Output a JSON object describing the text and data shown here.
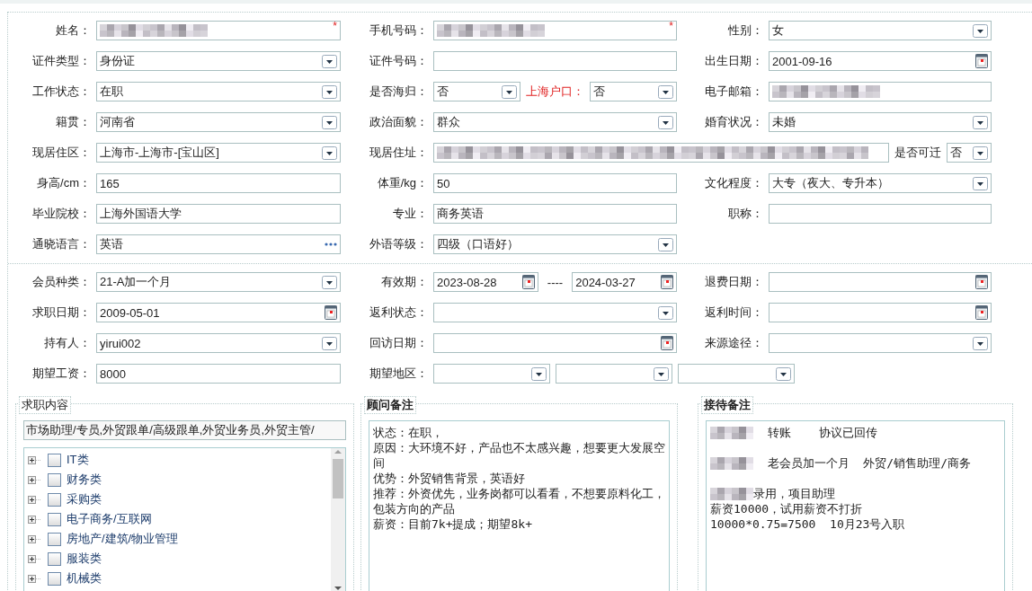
{
  "sections": [
    {
      "rows": [
        {
          "columns": [
            {
              "parts": [
                {
                  "kind": "label",
                  "text": "姓名："
                },
                {
                  "kind": "text",
                  "redacted": true,
                  "required_mark": "*"
                }
              ]
            },
            {
              "parts": [
                {
                  "kind": "label",
                  "text": "手机号码："
                },
                {
                  "kind": "text",
                  "redacted": true,
                  "required_mark": "*"
                }
              ]
            },
            {
              "parts": [
                {
                  "kind": "label",
                  "text": "性别："
                },
                {
                  "kind": "select",
                  "value": "女"
                }
              ]
            }
          ]
        },
        {
          "columns": [
            {
              "parts": [
                {
                  "kind": "label",
                  "text": "证件类型："
                },
                {
                  "kind": "select",
                  "value": "身份证"
                }
              ]
            },
            {
              "parts": [
                {
                  "kind": "label",
                  "text": "证件号码："
                },
                {
                  "kind": "text"
                }
              ]
            },
            {
              "parts": [
                {
                  "kind": "label",
                  "text": "出生日期："
                },
                {
                  "kind": "date",
                  "value": "2001-09-16"
                }
              ]
            }
          ]
        },
        {
          "columns": [
            {
              "parts": [
                {
                  "kind": "label",
                  "text": "工作状态："
                },
                {
                  "kind": "select",
                  "value": "在职"
                }
              ]
            },
            {
              "parts": [
                {
                  "kind": "label",
                  "text": "是否海归："
                },
                {
                  "kind": "select",
                  "value": "否"
                },
                {
                  "kind": "label",
                  "text": "上海户口：",
                  "emphasis": true
                },
                {
                  "kind": "select",
                  "value": "否"
                }
              ]
            },
            {
              "parts": [
                {
                  "kind": "label",
                  "text": "电子邮箱："
                },
                {
                  "kind": "text",
                  "redacted": true
                }
              ]
            }
          ]
        },
        {
          "columns": [
            {
              "parts": [
                {
                  "kind": "label",
                  "text": "籍贯："
                },
                {
                  "kind": "select",
                  "value": "河南省"
                }
              ]
            },
            {
              "parts": [
                {
                  "kind": "label",
                  "text": "政治面貌："
                },
                {
                  "kind": "select",
                  "value": "群众"
                }
              ]
            },
            {
              "parts": [
                {
                  "kind": "label",
                  "text": "婚育状况："
                },
                {
                  "kind": "select",
                  "value": "未婚"
                }
              ]
            }
          ]
        },
        {
          "columns": [
            {
              "parts": [
                {
                  "kind": "label",
                  "text": "现居住区："
                },
                {
                  "kind": "select",
                  "value": " 上海市-上海市-[宝山区]"
                }
              ]
            },
            {
              "parts": [
                {
                  "kind": "label",
                  "text": "现居住址："
                },
                {
                  "kind": "text",
                  "redacted": true
                },
                {
                  "kind": "label",
                  "text": "是否可迁"
                },
                {
                  "kind": "select",
                  "value": "否"
                }
              ]
            }
          ]
        },
        {
          "columns": [
            {
              "parts": [
                {
                  "kind": "label",
                  "text": "身高/cm："
                },
                {
                  "kind": "text",
                  "value": "165"
                }
              ]
            },
            {
              "parts": [
                {
                  "kind": "label",
                  "text": "体重/kg："
                },
                {
                  "kind": "text",
                  "value": "50"
                }
              ]
            },
            {
              "parts": [
                {
                  "kind": "label",
                  "text": "文化程度："
                },
                {
                  "kind": "select",
                  "value": "大专（夜大、专升本）"
                }
              ]
            }
          ]
        },
        {
          "columns": [
            {
              "parts": [
                {
                  "kind": "label",
                  "text": "毕业院校："
                },
                {
                  "kind": "text",
                  "value": "上海外国语大学"
                }
              ]
            },
            {
              "parts": [
                {
                  "kind": "label",
                  "text": "专业："
                },
                {
                  "kind": "text",
                  "value": "商务英语"
                }
              ]
            },
            {
              "parts": [
                {
                  "kind": "label",
                  "text": "职称："
                },
                {
                  "kind": "text"
                }
              ]
            }
          ]
        },
        {
          "columns": [
            {
              "parts": [
                {
                  "kind": "label",
                  "text": "通晓语言："
                },
                {
                  "kind": "lookup",
                  "value": "英语"
                }
              ]
            },
            {
              "parts": [
                {
                  "kind": "label",
                  "text": "外语等级："
                },
                {
                  "kind": "select",
                  "value": "四级（口语好）"
                }
              ]
            }
          ]
        }
      ]
    },
    {
      "rows": [
        {
          "columns": [
            {
              "parts": [
                {
                  "kind": "label",
                  "text": "会员种类："
                },
                {
                  "kind": "select",
                  "value": " 21-A加一个月"
                }
              ]
            },
            {
              "parts": [
                {
                  "kind": "label",
                  "text": "有效期："
                },
                {
                  "kind": "date",
                  "value": "2023-08-28"
                },
                {
                  "kind": "dash",
                  "text": "----"
                },
                {
                  "kind": "date",
                  "value": "2024-03-27"
                }
              ]
            },
            {
              "parts": [
                {
                  "kind": "label",
                  "text": "退费日期："
                },
                {
                  "kind": "date"
                }
              ]
            }
          ]
        },
        {
          "columns": [
            {
              "parts": [
                {
                  "kind": "label",
                  "text": "求职日期："
                },
                {
                  "kind": "date",
                  "value": "2009-05-01"
                }
              ]
            },
            {
              "parts": [
                {
                  "kind": "label",
                  "text": "返利状态："
                },
                {
                  "kind": "select"
                }
              ]
            },
            {
              "parts": [
                {
                  "kind": "label",
                  "text": "返利时间："
                },
                {
                  "kind": "date"
                }
              ]
            }
          ]
        },
        {
          "columns": [
            {
              "parts": [
                {
                  "kind": "label",
                  "text": "持有人："
                },
                {
                  "kind": "select",
                  "value": "yirui002"
                }
              ]
            },
            {
              "parts": [
                {
                  "kind": "label",
                  "text": "回访日期："
                },
                {
                  "kind": "date"
                }
              ]
            },
            {
              "parts": [
                {
                  "kind": "label",
                  "text": "来源途径："
                },
                {
                  "kind": "select"
                }
              ]
            }
          ]
        },
        {
          "columns": [
            {
              "parts": [
                {
                  "kind": "label",
                  "text": "期望工资："
                },
                {
                  "kind": "text",
                  "value": "8000"
                }
              ]
            },
            {
              "parts": [
                {
                  "kind": "label",
                  "text": "期望地区："
                },
                {
                  "kind": "select"
                },
                {
                  "kind": "select"
                },
                {
                  "kind": "select"
                }
              ]
            }
          ]
        }
      ]
    }
  ],
  "job_panel": {
    "legend": "求职内容",
    "strong": false,
    "value": "市场助理/专员,外贸跟单/高级跟单,外贸业务员,外贸主管/",
    "tree": [
      {
        "label": "IT类",
        "checked": false,
        "expanded": false
      },
      {
        "label": "财务类",
        "checked": false,
        "expanded": false
      },
      {
        "label": "采购类",
        "checked": false,
        "expanded": false
      },
      {
        "label": "电子商务/互联网",
        "checked": false,
        "expanded": false
      },
      {
        "label": "房地产/建筑/物业管理",
        "checked": false,
        "expanded": false
      },
      {
        "label": "服装类",
        "checked": false,
        "expanded": false
      },
      {
        "label": "机械类",
        "checked": false,
        "expanded": false
      }
    ]
  },
  "note_panels": [
    {
      "legend": "顾问备注",
      "strong": true,
      "lines": [
        {
          "kind": "text",
          "text": "状态：在职，"
        },
        {
          "kind": "text",
          "text": "原因：大环境不好，产品也不太感兴趣，想要更大发展空间"
        },
        {
          "kind": "text",
          "text": "优势：外贸销售背景，英语好"
        },
        {
          "kind": "text",
          "text": "推荐：外资优先，业务岗都可以看看，不想要原料化工，包装方向的产品"
        },
        {
          "kind": "text",
          "text": "薪资：目前7k+提成；期望8k+"
        }
      ]
    },
    {
      "legend": "接待备注",
      "strong": true,
      "lines": [
        {
          "kind": "redacted",
          "text": "  转账    协议已回传"
        },
        {
          "kind": "blank"
        },
        {
          "kind": "redacted",
          "text": "  老会员加一个月  外贸/销售助理/商务"
        },
        {
          "kind": "blank"
        },
        {
          "kind": "redacted",
          "text": "录用，项目助理"
        },
        {
          "kind": "text",
          "text": "薪资10000，试用薪资不打折"
        },
        {
          "kind": "text",
          "text": "10000*0.75=7500  10月23号入职"
        }
      ]
    }
  ]
}
